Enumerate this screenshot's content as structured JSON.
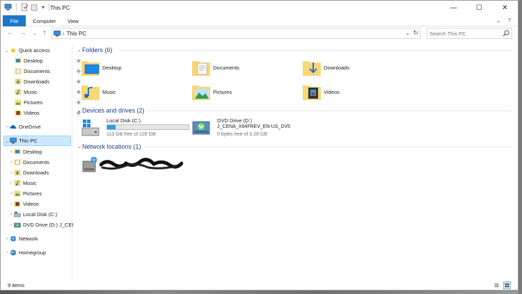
{
  "window": {
    "title": "This PC",
    "minimize_glyph": "—",
    "maximize_glyph": "☐",
    "close_glyph": "✕"
  },
  "quick_access_toolbar": {
    "icons": [
      "computer-icon",
      "properties-icon",
      "new-folder-icon",
      "customize-arrow-icon"
    ],
    "dropdown_glyph": "▾"
  },
  "ribbon": {
    "tabs": [
      {
        "label": "File",
        "active": true
      },
      {
        "label": "Computer",
        "active": false
      },
      {
        "label": "View",
        "active": false
      }
    ],
    "expand_glyph": "⌄",
    "help_glyph": "?"
  },
  "address_bar": {
    "back_glyph": "←",
    "forward_glyph": "→",
    "recent_glyph": "⌄",
    "up_glyph": "↑",
    "separator": "›",
    "path": "This PC",
    "dropdown_glyph": "⌄",
    "refresh_glyph": "↻"
  },
  "search": {
    "placeholder": "Search This PC"
  },
  "nav_pane": {
    "quick_access": {
      "label": "Quick access",
      "items": [
        {
          "label": "Desktop",
          "icon": "desktop-icon",
          "pinned": true
        },
        {
          "label": "Documents",
          "icon": "documents-icon",
          "pinned": true
        },
        {
          "label": "Downloads",
          "icon": "downloads-icon",
          "pinned": true
        },
        {
          "label": "Music",
          "icon": "music-icon",
          "pinned": true
        },
        {
          "label": "Pictures",
          "icon": "pictures-icon",
          "pinned": true
        },
        {
          "label": "Videos",
          "icon": "videos-icon",
          "pinned": true
        }
      ]
    },
    "onedrive": {
      "label": "OneDrive"
    },
    "this_pc": {
      "label": "This PC",
      "selected": true,
      "items": [
        {
          "label": "Desktop"
        },
        {
          "label": "Documents"
        },
        {
          "label": "Downloads"
        },
        {
          "label": "Music"
        },
        {
          "label": "Pictures"
        },
        {
          "label": "Videos"
        },
        {
          "label": "Local Disk (C:)"
        },
        {
          "label": "DVD Drive (D:) J_CEI"
        }
      ]
    },
    "network": {
      "label": "Network"
    },
    "homegroup": {
      "label": "Homegroup"
    },
    "pin_glyph": "📌",
    "expand_glyph": "›",
    "collapse_glyph": "⌄"
  },
  "content": {
    "folders": {
      "title": "Folders (6)",
      "items": [
        {
          "label": "Desktop",
          "icon": "desktop-folder-icon"
        },
        {
          "label": "Documents",
          "icon": "documents-folder-icon"
        },
        {
          "label": "Downloads",
          "icon": "downloads-folder-icon"
        },
        {
          "label": "Music",
          "icon": "music-folder-icon"
        },
        {
          "label": "Pictures",
          "icon": "pictures-folder-icon"
        },
        {
          "label": "Videos",
          "icon": "videos-folder-icon"
        }
      ]
    },
    "drives": {
      "title": "Devices and drives (2)",
      "items": [
        {
          "label": "Local Disk (C:)",
          "free_text": "113 GB free of 126 GB",
          "used_fraction": 0.1,
          "icon": "hard-disk-icon"
        },
        {
          "label": "DVD Drive (D:)",
          "volume_label": "J_CENA_X64FREV_EN-US_DV5",
          "free_text": "0 bytes free of 3.28 GB",
          "icon": "dvd-drive-icon"
        }
      ]
    },
    "network": {
      "title": "Network locations (1)",
      "items": [
        {
          "label": "",
          "redacted": true,
          "icon": "network-drive-icon"
        }
      ]
    }
  },
  "status_bar": {
    "item_count": "9 items",
    "views": [
      "details-view-icon",
      "large-icons-view-icon"
    ]
  },
  "colors": {
    "accent": "#1979ca",
    "selection": "#cce8ff",
    "group_title": "#1e3e8a",
    "drive_bar": "#26a0da",
    "folder_yellow": "#f8d775"
  }
}
